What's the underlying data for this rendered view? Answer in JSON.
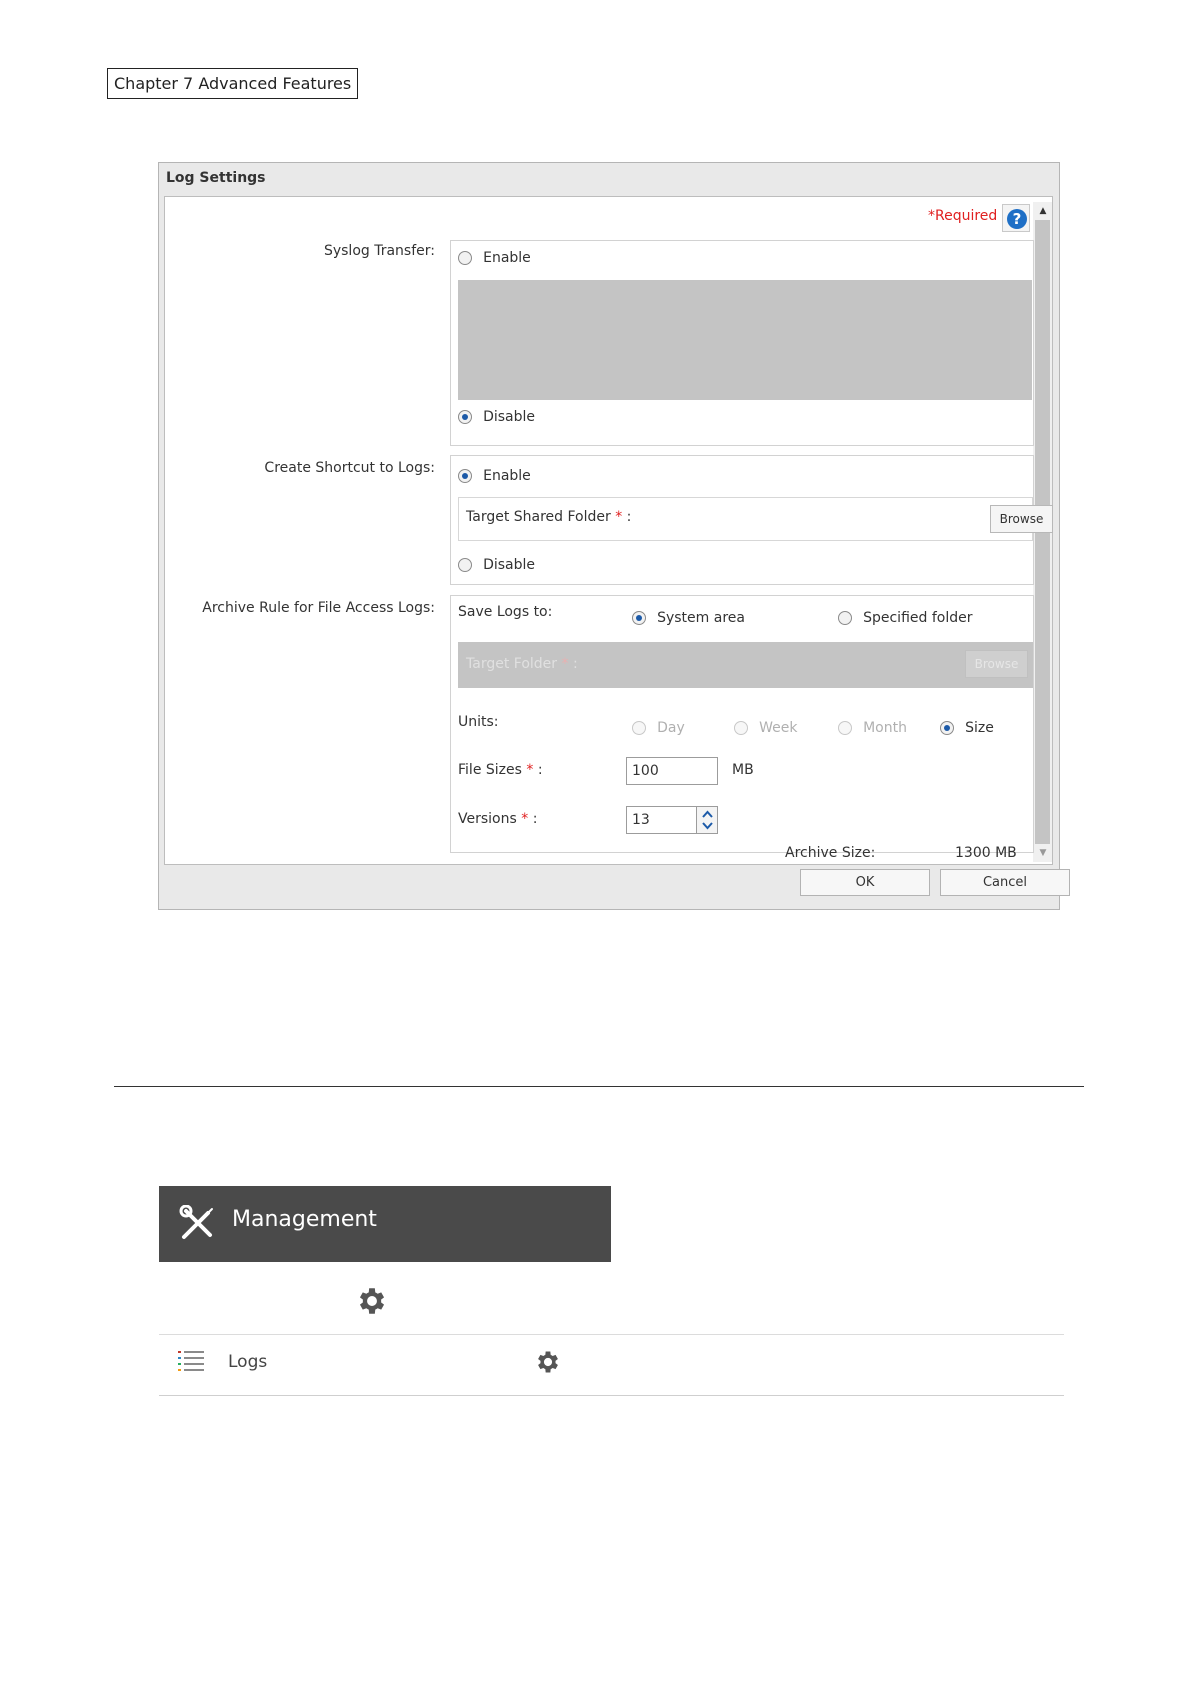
{
  "chapter": "Chapter 7 Advanced Features",
  "dialog": {
    "title": "Log Settings",
    "required": "*Required",
    "help": "?",
    "syslog": {
      "label": "Syslog Transfer:",
      "enable": "Enable",
      "disable": "Disable",
      "selected": "disable"
    },
    "shortcut": {
      "label": "Create Shortcut to Logs:",
      "enable": "Enable",
      "disable": "Disable",
      "target_label": "Target Shared Folder",
      "asterisk": "*",
      "colon": ":",
      "browse": "Browse",
      "selected": "enable"
    },
    "archive": {
      "label": "Archive Rule for File Access Logs:",
      "save_logs_to": "Save Logs to:",
      "system_area": "System area",
      "specified_folder": "Specified folder",
      "target_folder_label": "Target Folder",
      "asterisk": "*",
      "colon": ":",
      "browse": "Browse",
      "units_label": "Units:",
      "units": [
        "Day",
        "Week",
        "Month",
        "Size"
      ],
      "units_selected": "Size",
      "file_sizes_label": "File Sizes",
      "file_sizes_value": "100",
      "file_sizes_unit": "MB",
      "versions_label": "Versions",
      "versions_value": "13",
      "archive_size_label": "Archive Size:",
      "archive_size_value": "1300 MB"
    },
    "ok": "OK",
    "cancel": "Cancel"
  },
  "management": {
    "label": "Management",
    "icon": "tools-icon"
  },
  "logs_row": {
    "label": "Logs",
    "icon": "list-icon",
    "settings_icon": "gear-icon"
  },
  "colors": {
    "accent": "#1c5aa8",
    "required": "#e02020",
    "management_bar": "#4a4a4a"
  }
}
